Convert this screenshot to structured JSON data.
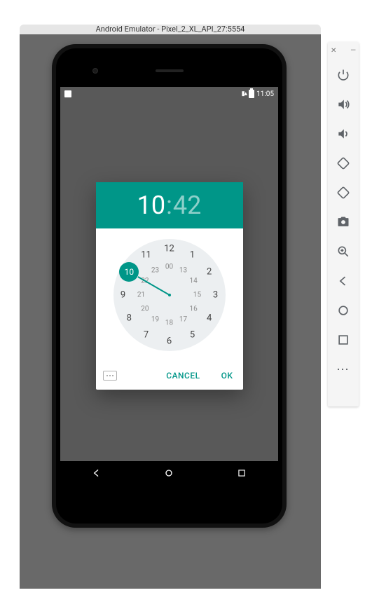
{
  "window": {
    "title": "Android Emulator - Pixel_2_XL_API_27:5554"
  },
  "statusbar": {
    "time": "11:05"
  },
  "timepicker": {
    "hour": "10",
    "minute": "42",
    "selected_outer_index": 10,
    "outer_hours": [
      "12",
      "1",
      "2",
      "3",
      "4",
      "5",
      "6",
      "7",
      "8",
      "9",
      "10",
      "11"
    ],
    "inner_hours": [
      "00",
      "13",
      "14",
      "15",
      "16",
      "17",
      "18",
      "19",
      "20",
      "21",
      "22",
      "23"
    ],
    "cancel_label": "CANCEL",
    "ok_label": "OK"
  },
  "colors": {
    "accent": "#009688"
  }
}
